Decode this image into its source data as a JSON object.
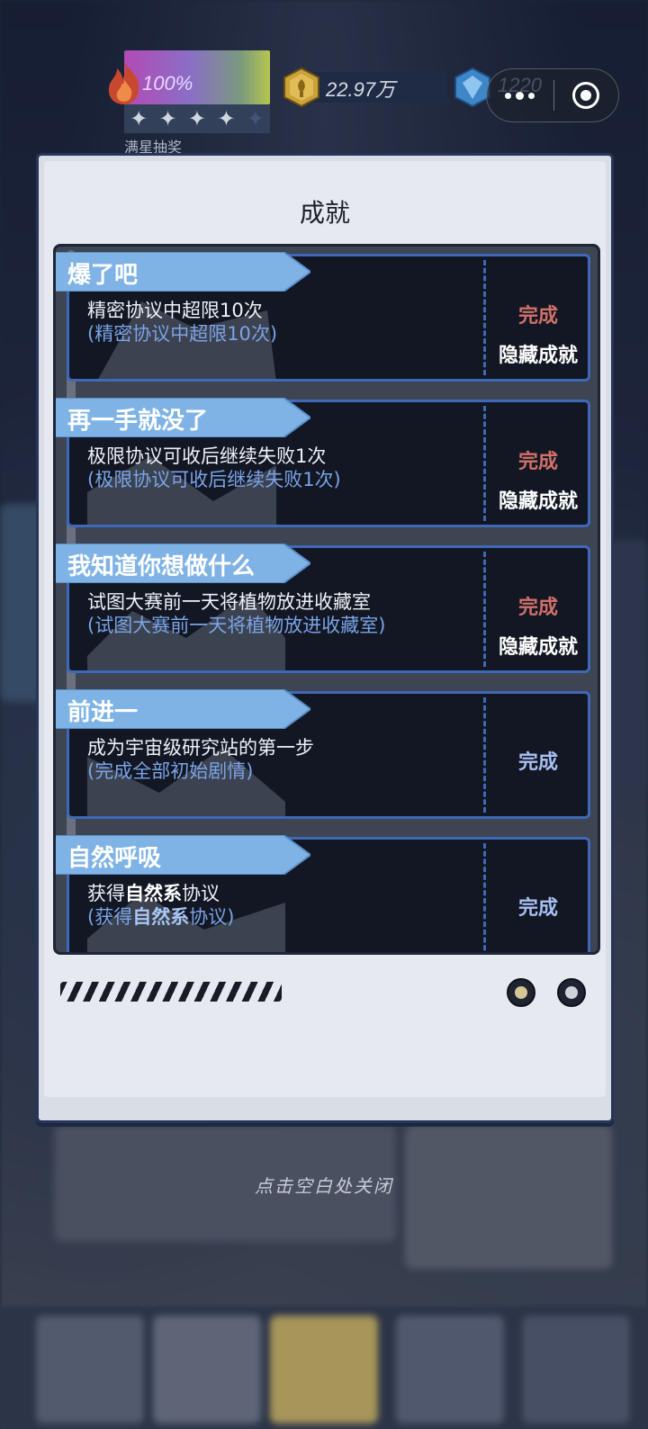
{
  "hud": {
    "energy_percent_text": "100%",
    "stars_filled": 4,
    "stars_total": 5,
    "star_glyph": "✦",
    "caption": "满星抽奖",
    "coins_text": "22.97万",
    "gems_text": "1220",
    "icons": {
      "energy": "flame-icon",
      "coins": "coin-icon",
      "gems": "gem-icon",
      "more": "more-dots-icon",
      "close": "target-close-icon"
    }
  },
  "modal": {
    "title": "成就",
    "achievements": [
      {
        "title": "爆了吧",
        "desc": "精密协议中超限10次",
        "desc_sub": "(精密协议中超限10次)",
        "status": "完成",
        "hidden_tag": "隐藏成就"
      },
      {
        "title": "再一手就没了",
        "desc": "极限协议可收后继续失败1次",
        "desc_sub": "(极限协议可收后继续失败1次)",
        "status": "完成",
        "hidden_tag": "隐藏成就"
      },
      {
        "title": "我知道你想做什么",
        "desc": "试图大赛前一天将植物放进收藏室",
        "desc_sub": "(试图大赛前一天将植物放进收藏室)",
        "status": "完成",
        "hidden_tag": "隐藏成就"
      },
      {
        "title": "前进一",
        "desc": "成为宇宙级研究站的第一步",
        "desc_sub": "(完成全部初始剧情)",
        "status": "完成"
      },
      {
        "title": "自然呼吸",
        "desc_prefix": "获得",
        "desc_bold": "自然系",
        "desc_suffix": "协议",
        "desc_sub_prefix": "(获得",
        "desc_sub_bold": "自然系",
        "desc_sub_suffix": "协议)",
        "status": "完成"
      }
    ]
  },
  "close_hint": "点击空白处关闭",
  "colors": {
    "status_hidden": "#d0706a",
    "status_normal": "#a8bff2",
    "card_border": "#3f68b8",
    "banner": "#7fb3e6"
  }
}
